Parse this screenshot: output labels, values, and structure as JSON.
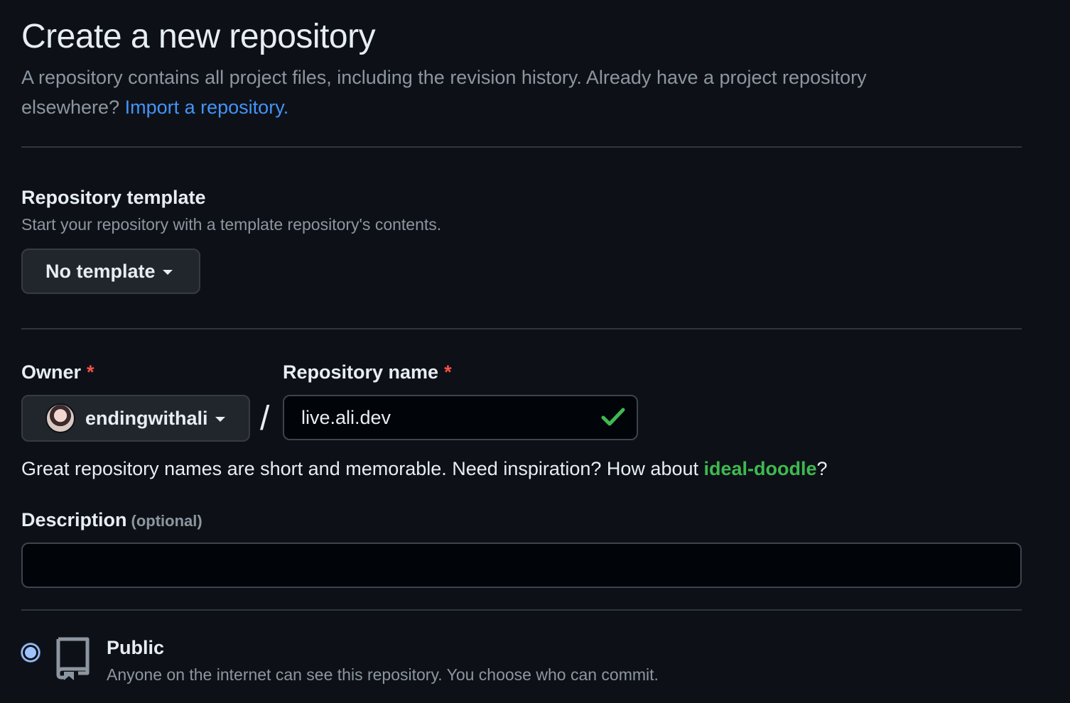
{
  "page": {
    "title": "Create a new repository",
    "intro_text": "A repository contains all project files, including the revision history. Already have a project repository elsewhere?",
    "import_link": "Import a repository."
  },
  "template_section": {
    "heading": "Repository template",
    "note": "Start your repository with a template repository's contents.",
    "button_label": "No template"
  },
  "owner": {
    "label": "Owner",
    "required_mark": "*",
    "selected": "endingwithali"
  },
  "separator": "/",
  "repo_name": {
    "label": "Repository name",
    "required_mark": "*",
    "value": "live.ali.dev",
    "status": "valid"
  },
  "hint": {
    "prefix": "Great repository names are short and memorable. Need inspiration? How about",
    "suggestion": "ideal-doodle",
    "suffix": "?"
  },
  "description": {
    "label": "Description",
    "optional_note": "(optional)",
    "value": "",
    "placeholder": ""
  },
  "visibility": {
    "selected": "public",
    "public_label": "Public",
    "public_note": "Anyone on the internet can see this repository. You choose who can commit."
  },
  "colors": {
    "background": "#0d1117",
    "text": "#e6edf3",
    "muted": "#8d96a0",
    "link": "#4493f8",
    "success": "#3fb950",
    "danger": "#f85149"
  },
  "icons": {
    "caret": "chevron-down-icon",
    "check": "check-icon",
    "repo": "repo-icon"
  }
}
